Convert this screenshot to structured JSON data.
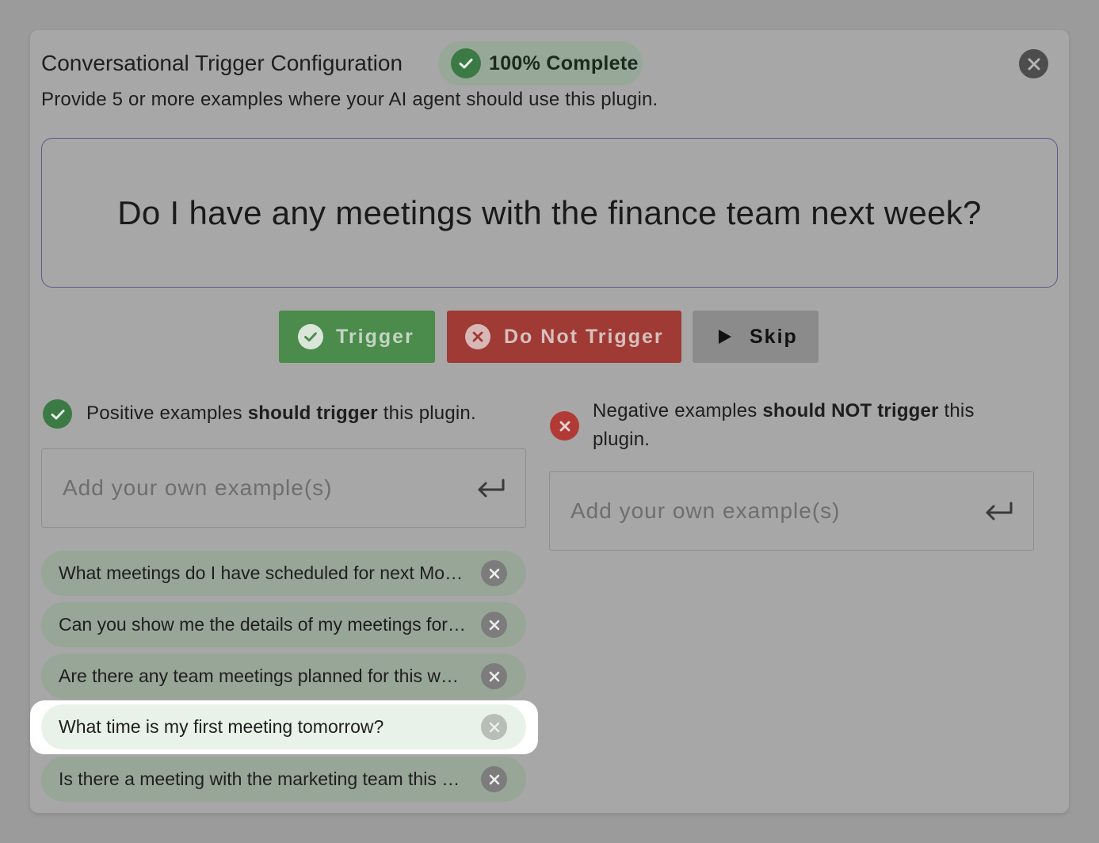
{
  "dialog": {
    "title": "Conversational Trigger Configuration",
    "badge": {
      "icon": "check-circle-icon",
      "label": "100% Complete"
    },
    "close_icon": "close-icon",
    "subtitle": "Provide 5 or more examples where your AI agent should use this plugin."
  },
  "question": "Do I have any meetings with the finance team next week?",
  "actions": {
    "trigger": {
      "label": "Trigger",
      "icon": "check-circle-icon",
      "color": "#4b8b4b"
    },
    "do_not_trigger": {
      "label": "Do Not Trigger",
      "icon": "x-circle-icon",
      "color": "#a03a34"
    },
    "skip": {
      "label": "Skip",
      "icon": "play-icon",
      "color": "#8b8b8b"
    }
  },
  "positive": {
    "heading_pre": "Positive examples ",
    "heading_bold": "should trigger",
    "heading_post": " this plugin.",
    "input_placeholder": "Add your own example(s)",
    "examples": [
      "What meetings do I have scheduled for next Monday?",
      "Can you show me the details of my meetings for tomorrow?",
      "Are there any team meetings planned for this week?",
      "What time is my first meeting tomorrow?",
      "Is there a meeting with the marketing team this week?"
    ],
    "highlighted_index": 3
  },
  "negative": {
    "heading_pre": "Negative examples ",
    "heading_bold": "should NOT trigger",
    "heading_post": " this plugin.",
    "input_placeholder": "Add your own example(s)",
    "examples": []
  }
}
